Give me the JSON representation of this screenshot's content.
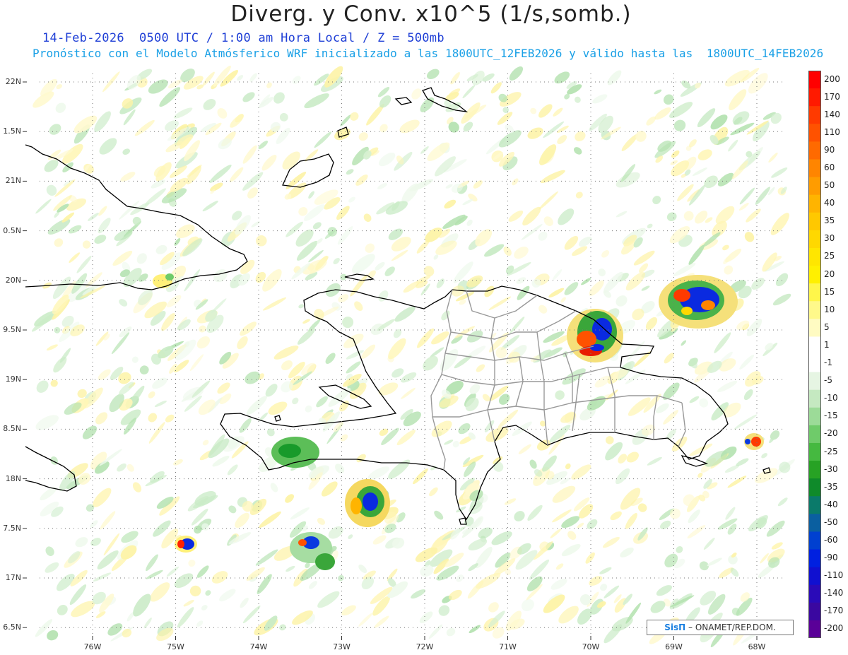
{
  "header": {
    "title": "Diverg. y Conv. x10^5 (1/s,somb.)",
    "line1": "14-Feb-2026  0500 UTC / 1:00 am Hora Local / Z = 500mb",
    "line2": "Pronóstico con el Modelo Atmósferico WRF inicializado a las 1800UTC_12FEB2026 y válido hasta las  1800UTC_14FEB2026"
  },
  "map": {
    "lat_labels": [
      "22N",
      "1.5N",
      "21N",
      "0.5N",
      "20N",
      "9.5N",
      "19N",
      "8.5N",
      "18N",
      "7.5N",
      "17N",
      "6.5N"
    ],
    "lon_labels": [
      "76W",
      "75W",
      "74W",
      "73W",
      "72W",
      "71W",
      "70W",
      "69W",
      "68W"
    ],
    "colors": {
      "coast": "#000000",
      "provinces": "#999999",
      "grid": "#777777",
      "yellow_light": "#fff6b8",
      "green_light": "#c9ebc6"
    }
  },
  "colorbar": {
    "labels": [
      "200",
      "170",
      "140",
      "110",
      "90",
      "60",
      "50",
      "40",
      "35",
      "30",
      "25",
      "20",
      "15",
      "10",
      "5",
      "1",
      "-1",
      "-5",
      "-10",
      "-15",
      "-20",
      "-25",
      "-30",
      "-35",
      "-40",
      "-50",
      "-60",
      "-90",
      "-110",
      "-140",
      "-170",
      "-200"
    ],
    "colors": [
      "#ff0000",
      "#ff1a00",
      "#ff3a00",
      "#ff5200",
      "#ff6a00",
      "#ff8500",
      "#ff9c00",
      "#ffb400",
      "#ffc800",
      "#ffd800",
      "#ffe600",
      "#fff000",
      "#fff64a",
      "#fff98a",
      "#fffbc2",
      "#ffffff",
      "#ffffff",
      "#e6f5e3",
      "#c5e9c1",
      "#9cdb98",
      "#6fcb6a",
      "#45b940",
      "#27a224",
      "#0f8a2a",
      "#0a7a6a",
      "#0a5fa0",
      "#0040d0",
      "#0020e0",
      "#1010d0",
      "#2a0ab8",
      "#3a08a0",
      "#5a0098"
    ]
  },
  "credit": {
    "brand": "SisΠ",
    "text": "– ONAMET/REP.DOM."
  }
}
